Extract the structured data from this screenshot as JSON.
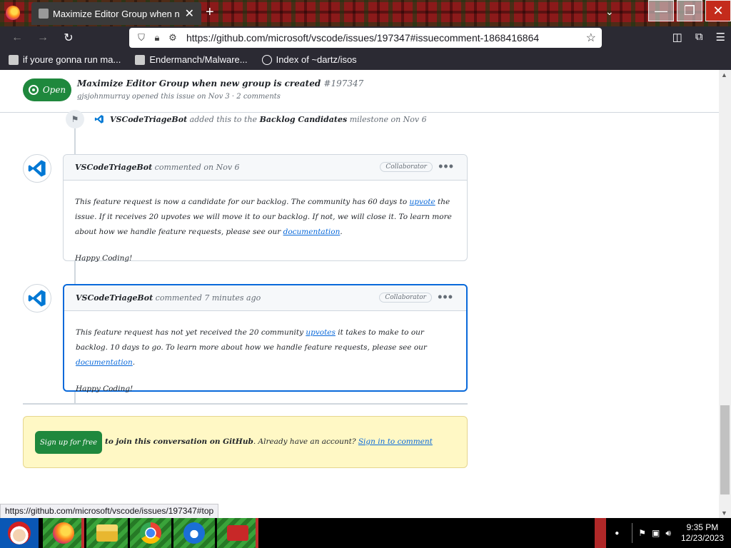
{
  "browser": {
    "tab": {
      "title": "Maximize Editor Group when new",
      "close_glyph": "✕"
    },
    "new_tab_glyph": "+",
    "tab_list_glyph": "⌄",
    "window_controls": {
      "minimize": "—",
      "restore": "❐",
      "close": "✕"
    },
    "nav": {
      "back": "←",
      "forward": "→",
      "reload": "↻"
    },
    "url": "https://github.com/microsoft/vscode/issues/197347#issuecomment-1868416864",
    "bookmarks": [
      {
        "label": "if youre gonna run ma...",
        "icon": "page-icon"
      },
      {
        "label": "Endermanch/Malware...",
        "icon": "github-icon"
      },
      {
        "label": "Index of ~dartz/isos",
        "icon": "globe-icon"
      }
    ]
  },
  "issue": {
    "state": "Open",
    "title": "Maximize Editor Group when new group is created",
    "number": "#197347",
    "meta": "gjsjohnmurray opened this issue on Nov 3 · 2 comments"
  },
  "event": {
    "actor": "VSCodeTriageBot",
    "text": "added this to the",
    "milestone": "Backlog Candidates",
    "suffix": "milestone on Nov 6"
  },
  "comments": [
    {
      "author": "VSCodeTriageBot",
      "when": "commented on Nov 6",
      "role": "Collaborator",
      "paragraph1_pre": "This feature request is now a candidate for our backlog. The community has 60 days to ",
      "link1": "upvote",
      "paragraph1_mid": " the issue. If it receives 20 upvotes we will move it to our backlog. If not, we will close it. To learn more about how we handle feature requests, please see our ",
      "link2": "documentation",
      "paragraph1_end": ".",
      "signoff": "Happy Coding!"
    },
    {
      "author": "VSCodeTriageBot",
      "when": "commented 7 minutes ago",
      "role": "Collaborator",
      "paragraph1_pre": "This feature request has not yet received the 20 community ",
      "link1": "upvotes",
      "paragraph1_mid": " it takes to make to our backlog. 10 days to go. To learn more about how we handle feature requests, please see our ",
      "link2": "documentation",
      "paragraph1_end": ".",
      "signoff": "Happy Coding!"
    }
  ],
  "signup": {
    "button": "Sign up for free",
    "text_bold": "to join this conversation on GitHub",
    "text": ". Already have an account? ",
    "link": "Sign in to comment"
  },
  "status_link": "https://github.com/microsoft/vscode/issues/197347#top",
  "taskbar": {
    "apps": [
      "firefox-icon",
      "file-explorer-icon",
      "chrome-icon",
      "thunderbird-icon",
      "toolbox-icon"
    ],
    "time": "9:35 PM",
    "date": "12/23/2023"
  },
  "colors": {
    "accent": "#0969da",
    "success": "#1f883d",
    "signup_bg": "#fff8c5"
  }
}
